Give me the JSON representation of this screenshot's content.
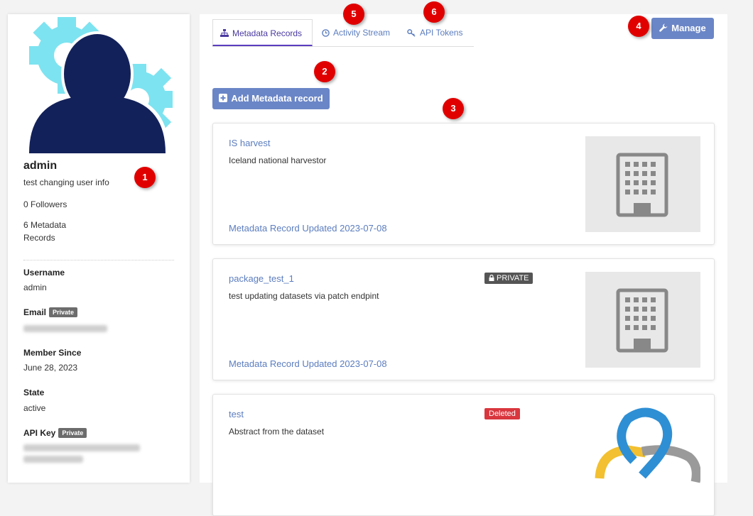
{
  "profile": {
    "name": "admin",
    "about": "test changing user info",
    "followers": "0 Followers",
    "records_count": "6 Metadata Records",
    "fields": [
      {
        "label": "Username",
        "value": "admin"
      },
      {
        "label": "Email",
        "badge": "Private"
      },
      {
        "label": "Member Since",
        "value": "June 28, 2023"
      },
      {
        "label": "State",
        "value": "active"
      },
      {
        "label": "API Key",
        "badge": "Private"
      }
    ]
  },
  "tabs": [
    {
      "label": "Metadata Records",
      "icon": "sitemap-icon"
    },
    {
      "label": "Activity Stream",
      "icon": "clock-icon"
    },
    {
      "label": "API Tokens",
      "icon": "key-icon"
    }
  ],
  "actions": {
    "manage": "Manage",
    "add_record": "Add Metadata record"
  },
  "records": [
    {
      "title": "IS harvest",
      "description": "Iceland national harvestor",
      "updated": "Metadata Record Updated 2023-07-08",
      "image": "building-placeholder"
    },
    {
      "title": "package_test_1",
      "description": "test updating datasets via patch endpint",
      "badge": "PRIVATE",
      "updated": "Metadata Record Updated 2023-07-08",
      "image": "building-placeholder"
    },
    {
      "title": "test",
      "description": "Abstract from the dataset",
      "badge": "Deleted",
      "image": "dataset-logo"
    }
  ],
  "markers": [
    "1",
    "2",
    "3",
    "4",
    "5",
    "6"
  ],
  "colors": {
    "accent": "#6b86c7",
    "link": "#5b7dbf",
    "active_tab": "#5a3dbf",
    "private_badge": "#555555",
    "deleted_badge": "#d9363e",
    "marker": "#e00000",
    "avatar_dark": "#13215a",
    "avatar_gear": "#7de3f0"
  }
}
